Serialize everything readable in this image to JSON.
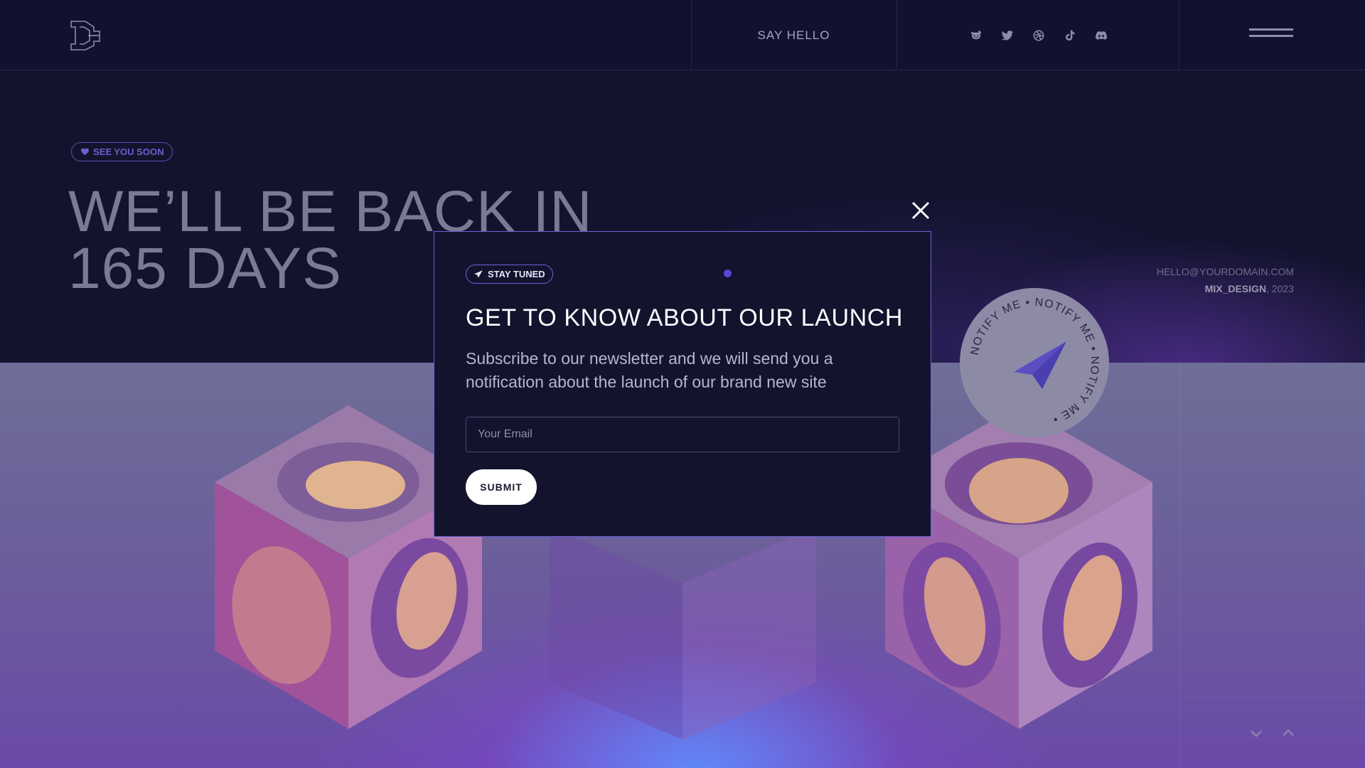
{
  "header": {
    "say_hello": "SAY HELLO",
    "social_icons": [
      "reddit-icon",
      "twitter-icon",
      "dribbble-icon",
      "tiktok-icon",
      "discord-icon"
    ],
    "logo_icon": "logo-icon",
    "menu_icon": "hamburger-menu-icon"
  },
  "hero": {
    "badge": "SEE YOU SOON",
    "title_line1": "WE’LL BE BACK IN",
    "title_line2": "165 DAYS",
    "contact_email": "HELLO@YOURDOMAIN.COM",
    "brand": "MIX_DESIGN",
    "year": ", 2023"
  },
  "notify_circle": {
    "text": "NOTIFY ME • NOTIFY ME • NOTIFY ME • ",
    "icon": "paper-plane-icon"
  },
  "modal": {
    "badge": "STAY TUNED",
    "title": "GET TO KNOW ABOUT OUR LAUNCH",
    "description": "Subscribe to our newsletter and we will send you a notification about the launch of our brand new site",
    "email_placeholder": "Your Email",
    "email_value": "",
    "submit_label": "SUBMIT"
  },
  "colors": {
    "background": "#13132e",
    "accent": "#6b62d8",
    "button": "#ffffff"
  }
}
